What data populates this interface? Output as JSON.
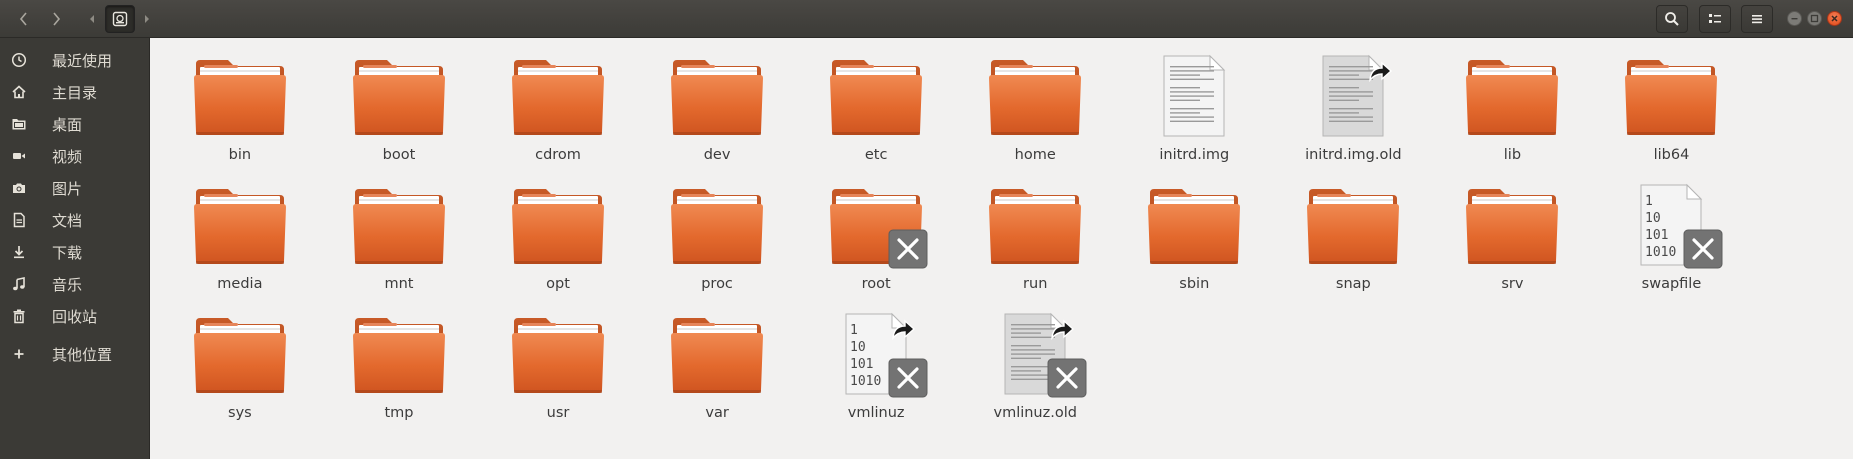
{
  "colors": {
    "header_bg": "#3c3b37",
    "sidebar_bg": "#3b3a36",
    "content_bg": "#f2f1f0",
    "folder_orange": "#e3692d",
    "close_button": "#df4a16"
  },
  "sidebar": {
    "items": [
      {
        "label": "最近使用",
        "icon": "clock-icon"
      },
      {
        "label": "主目录",
        "icon": "home-icon"
      },
      {
        "label": "桌面",
        "icon": "desktop-folder-icon"
      },
      {
        "label": "视频",
        "icon": "video-icon"
      },
      {
        "label": "图片",
        "icon": "camera-icon"
      },
      {
        "label": "文档",
        "icon": "document-icon"
      },
      {
        "label": "下载",
        "icon": "download-icon"
      },
      {
        "label": "音乐",
        "icon": "music-icon"
      },
      {
        "label": "回收站",
        "icon": "trash-icon"
      },
      {
        "label": "其他位置",
        "icon": "plus-icon"
      }
    ]
  },
  "files": [
    {
      "name": "bin",
      "type": "folder"
    },
    {
      "name": "boot",
      "type": "folder"
    },
    {
      "name": "cdrom",
      "type": "folder"
    },
    {
      "name": "dev",
      "type": "folder"
    },
    {
      "name": "etc",
      "type": "folder"
    },
    {
      "name": "home",
      "type": "folder"
    },
    {
      "name": "initrd.img",
      "type": "text"
    },
    {
      "name": "initrd.img.old",
      "type": "text-link"
    },
    {
      "name": "lib",
      "type": "folder"
    },
    {
      "name": "lib64",
      "type": "folder"
    },
    {
      "name": "media",
      "type": "folder"
    },
    {
      "name": "mnt",
      "type": "folder"
    },
    {
      "name": "opt",
      "type": "folder"
    },
    {
      "name": "proc",
      "type": "folder"
    },
    {
      "name": "root",
      "type": "folder-locked"
    },
    {
      "name": "run",
      "type": "folder"
    },
    {
      "name": "sbin",
      "type": "folder"
    },
    {
      "name": "snap",
      "type": "folder"
    },
    {
      "name": "srv",
      "type": "folder"
    },
    {
      "name": "swapfile",
      "type": "binary-locked"
    },
    {
      "name": "sys",
      "type": "folder"
    },
    {
      "name": "tmp",
      "type": "folder"
    },
    {
      "name": "usr",
      "type": "folder"
    },
    {
      "name": "var",
      "type": "folder"
    },
    {
      "name": "vmlinuz",
      "type": "binary-link-locked"
    },
    {
      "name": "vmlinuz.old",
      "type": "text-link-locked"
    }
  ],
  "binary_glyph_lines": [
    "1",
    "10",
    "101",
    "1010"
  ]
}
